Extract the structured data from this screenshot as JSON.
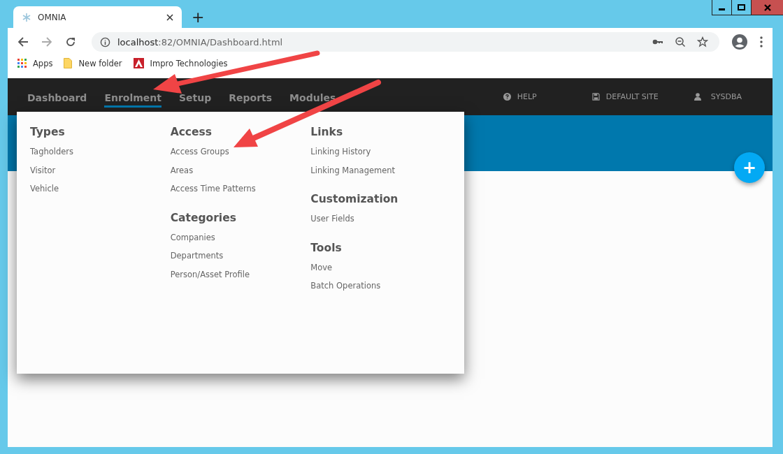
{
  "browser": {
    "tab_title": "OMNIA",
    "new_tab": "+",
    "url_host": "localhost",
    "url_path": ":82/OMNIA/Dashboard.html",
    "bookmarks": [
      {
        "label": "Apps",
        "kind": "apps"
      },
      {
        "label": "New folder",
        "kind": "folder"
      },
      {
        "label": "Impro Technologies",
        "kind": "site"
      }
    ]
  },
  "nav": {
    "items": [
      {
        "label": "Dashboard",
        "selected": false
      },
      {
        "label": "Enrolment",
        "selected": true
      },
      {
        "label": "Setup",
        "selected": false
      },
      {
        "label": "Reports",
        "selected": false
      },
      {
        "label": "Modules",
        "selected": false
      }
    ],
    "right": [
      {
        "label": "HELP",
        "kind": "help"
      },
      {
        "label": "DEFAULT SITE",
        "kind": "site"
      },
      {
        "label": "SYSDBA",
        "kind": "user"
      }
    ]
  },
  "menu": {
    "columns": [
      [
        {
          "heading": "Types",
          "items": [
            "Tagholders",
            "Visitor",
            "Vehicle"
          ]
        }
      ],
      [
        {
          "heading": "Access",
          "items": [
            "Access Groups",
            "Areas",
            "Access Time Patterns"
          ]
        },
        {
          "heading": "Categories",
          "items": [
            "Companies",
            "Departments",
            "Person/Asset Profile"
          ]
        }
      ],
      [
        {
          "heading": "Links",
          "items": [
            "Linking History",
            "Linking Management"
          ]
        },
        {
          "heading": "Customization",
          "items": [
            "User Fields"
          ]
        },
        {
          "heading": "Tools",
          "items": [
            "Move",
            "Batch Operations"
          ]
        }
      ]
    ]
  },
  "fab": {
    "label": "+"
  }
}
